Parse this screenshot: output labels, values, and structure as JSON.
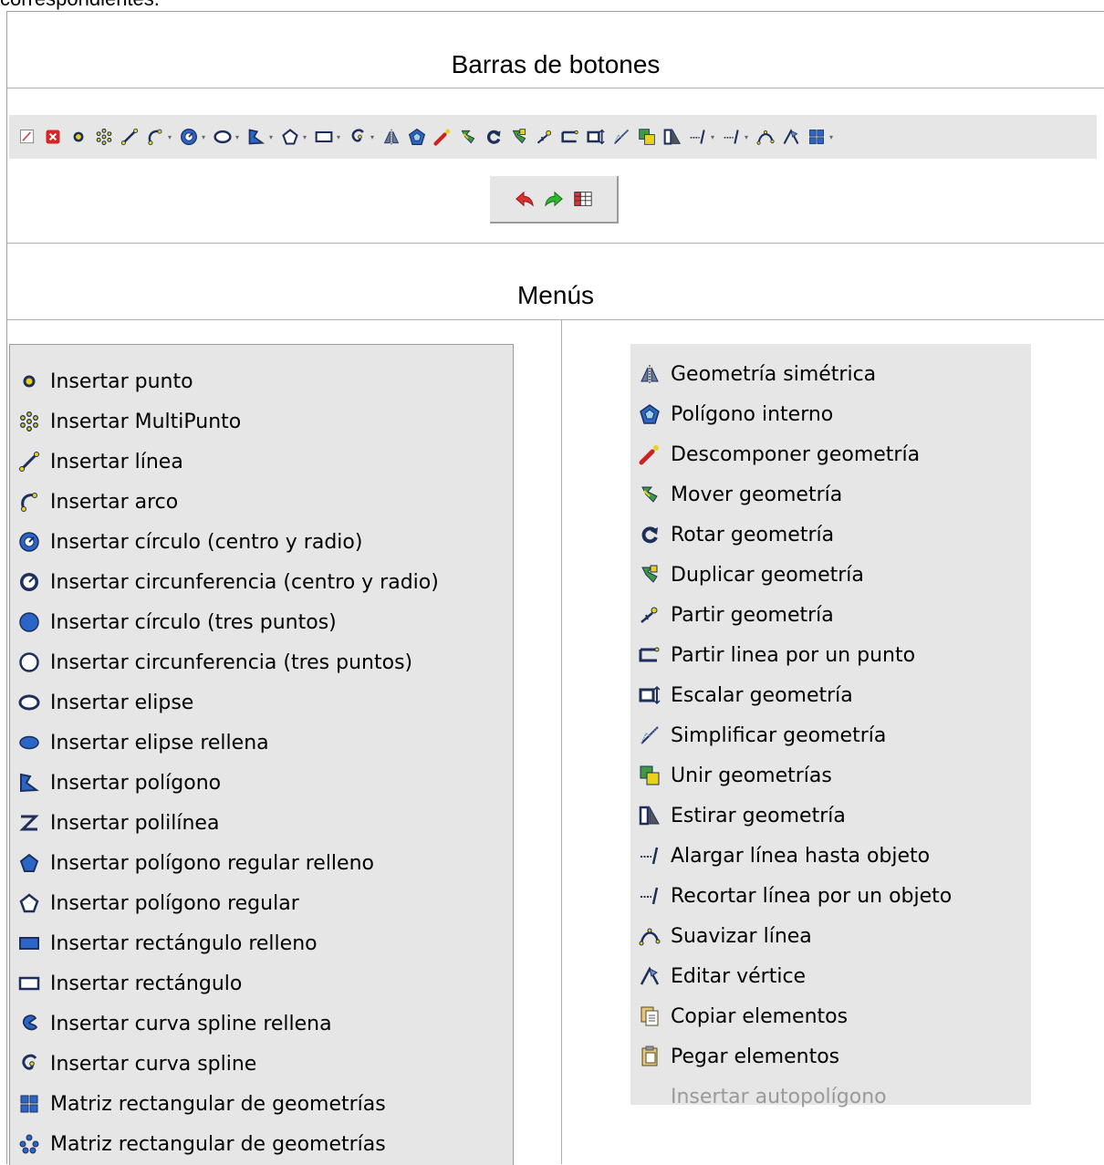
{
  "page": {
    "top_text": "correspondientes."
  },
  "sections": {
    "toolbars_title": "Barras de botones",
    "menus_title": "Menús"
  },
  "toolbar": {
    "main_icons": [
      "edit-toggle-icon",
      "stop-edit-icon",
      "point-icon",
      "multipoint-icon",
      "line-icon",
      "arc-icon",
      "circle-icon",
      "ellipse-icon",
      "polygon-icon",
      "regular-polygon-icon",
      "rectangle-icon",
      "spline-icon",
      "symmetry-icon",
      "internal-polygon-icon",
      "explode-icon",
      "move-icon",
      "rotate-icon",
      "duplicate-icon",
      "split-icon",
      "split-line-icon",
      "scale-icon",
      "simplify-icon",
      "join-icon",
      "stretch-icon",
      "extend-line-icon",
      "trim-line-icon",
      "smooth-line-icon",
      "edit-vertex-icon",
      "matrix-icon"
    ],
    "undo_icons": [
      "undo-icon",
      "redo-icon",
      "table-icon"
    ]
  },
  "menu_left": {
    "items": [
      {
        "label": "Insertar punto",
        "icon": "point-icon"
      },
      {
        "label": "Insertar MultiPunto",
        "icon": "multipoint-icon"
      },
      {
        "label": "Insertar línea",
        "icon": "line-icon"
      },
      {
        "label": "Insertar arco",
        "icon": "arc-icon"
      },
      {
        "label": "Insertar círculo (centro y radio)",
        "icon": "circle-center-radius-icon"
      },
      {
        "label": "Insertar circunferencia (centro y radio)",
        "icon": "circumference-center-radius-icon"
      },
      {
        "label": "Insertar círculo (tres puntos)",
        "icon": "circle-three-points-icon"
      },
      {
        "label": "Insertar circunferencia (tres puntos)",
        "icon": "circumference-three-points-icon"
      },
      {
        "label": "Insertar elipse",
        "icon": "ellipse-icon"
      },
      {
        "label": "Insertar elipse rellena",
        "icon": "filled-ellipse-icon"
      },
      {
        "label": "Insertar polígono",
        "icon": "polygon-icon"
      },
      {
        "label": "Insertar polilínea",
        "icon": "polyline-icon"
      },
      {
        "label": "Insertar polígono regular relleno",
        "icon": "filled-regular-polygon-icon"
      },
      {
        "label": "Insertar polígono regular",
        "icon": "regular-polygon-icon"
      },
      {
        "label": "Insertar rectángulo relleno",
        "icon": "filled-rectangle-icon"
      },
      {
        "label": "Insertar rectángulo",
        "icon": "rectangle-icon"
      },
      {
        "label": "Insertar curva spline rellena",
        "icon": "filled-spline-icon"
      },
      {
        "label": "Insertar curva spline",
        "icon": "spline-icon"
      },
      {
        "label": "Matriz rectangular de geometrías",
        "icon": "rectangular-matrix-icon"
      },
      {
        "label": "Matriz rectangular de geometrías",
        "icon": "polar-matrix-icon"
      }
    ]
  },
  "menu_right": {
    "items": [
      {
        "label": "Geometría simétrica",
        "icon": "symmetry-icon",
        "enabled": true
      },
      {
        "label": "Polígono interno",
        "icon": "internal-polygon-icon",
        "enabled": true
      },
      {
        "label": "Descomponer geometría",
        "icon": "explode-icon",
        "enabled": true
      },
      {
        "label": "Mover geometría",
        "icon": "move-icon",
        "enabled": true
      },
      {
        "label": "Rotar geometría",
        "icon": "rotate-icon",
        "enabled": true
      },
      {
        "label": "Duplicar geometría",
        "icon": "duplicate-icon",
        "enabled": true
      },
      {
        "label": "Partir geometría",
        "icon": "split-icon",
        "enabled": true
      },
      {
        "label": "Partir linea por un punto",
        "icon": "split-line-icon",
        "enabled": true
      },
      {
        "label": "Escalar geometría",
        "icon": "scale-icon",
        "enabled": true
      },
      {
        "label": "Simplificar geometría",
        "icon": "simplify-icon",
        "enabled": true
      },
      {
        "label": "Unir geometrías",
        "icon": "join-icon",
        "enabled": true
      },
      {
        "label": "Estirar geometría",
        "icon": "stretch-icon",
        "enabled": true
      },
      {
        "label": "Alargar línea hasta objeto",
        "icon": "extend-line-icon",
        "enabled": true
      },
      {
        "label": "Recortar línea por un objeto",
        "icon": "trim-line-icon",
        "enabled": true
      },
      {
        "label": "Suavizar línea",
        "icon": "smooth-line-icon",
        "enabled": true
      },
      {
        "label": "Editar vértice",
        "icon": "edit-vertex-icon",
        "enabled": true
      },
      {
        "label": "Copiar elementos",
        "icon": "copy-icon",
        "enabled": true
      },
      {
        "label": "Pegar elementos",
        "icon": "paste-icon",
        "enabled": true
      },
      {
        "label": "Insertar autopolígono",
        "icon": "autopolygon-icon",
        "enabled": false
      }
    ]
  },
  "colors": {
    "menu_bg": "#e6e6e6",
    "icon_blue": "#2a66c8",
    "icon_dark": "#1d2f5a",
    "icon_yellow": "#e8d21a",
    "undo_red": "#d93030",
    "redo_green": "#2fb52f",
    "disabled_text": "#9a9a9a"
  }
}
